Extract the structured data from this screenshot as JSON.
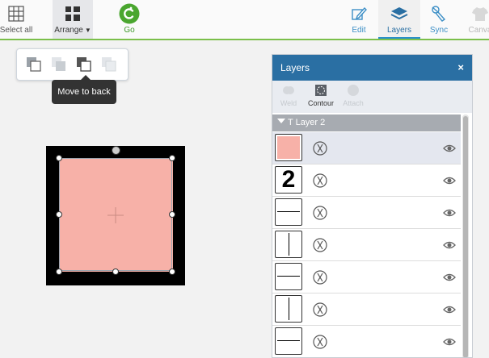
{
  "toolbar": {
    "select_all_label": "Select all",
    "arrange_label": "Arrange",
    "go_label": "Go",
    "edit_label": "Edit",
    "layers_label": "Layers",
    "sync_label": "Sync",
    "canvas_label": "Canva"
  },
  "arrange_menu": {
    "tooltip": "Move to back",
    "items": [
      "send-to-back-icon",
      "move-backward-icon",
      "move-to-back-icon",
      "bring-forward-icon"
    ]
  },
  "layers_panel": {
    "title": "Layers",
    "close_glyph": "×",
    "tools": {
      "weld": "Weld",
      "contour": "Contour",
      "attach": "Attach"
    },
    "group_label": "T Layer 2",
    "rows": [
      {
        "thumb": "pink-square",
        "cut": "cut-icon",
        "visible": true
      },
      {
        "thumb": "2",
        "cut": "cut-icon",
        "visible": true
      },
      {
        "thumb": "horizontal-line",
        "cut": "cut-icon",
        "visible": true
      },
      {
        "thumb": "vertical-line",
        "cut": "cut-icon",
        "visible": true
      },
      {
        "thumb": "horizontal-line",
        "cut": "cut-icon",
        "visible": true
      },
      {
        "thumb": "vertical-line",
        "cut": "cut-icon",
        "visible": true
      },
      {
        "thumb": "horizontal-line",
        "cut": "cut-icon",
        "visible": true
      }
    ]
  },
  "colors": {
    "accent": "#2a6fa3",
    "go_green": "#3f9a2a",
    "shape_fill": "#f7b1a8",
    "selected_row": "#e4e7ef"
  }
}
